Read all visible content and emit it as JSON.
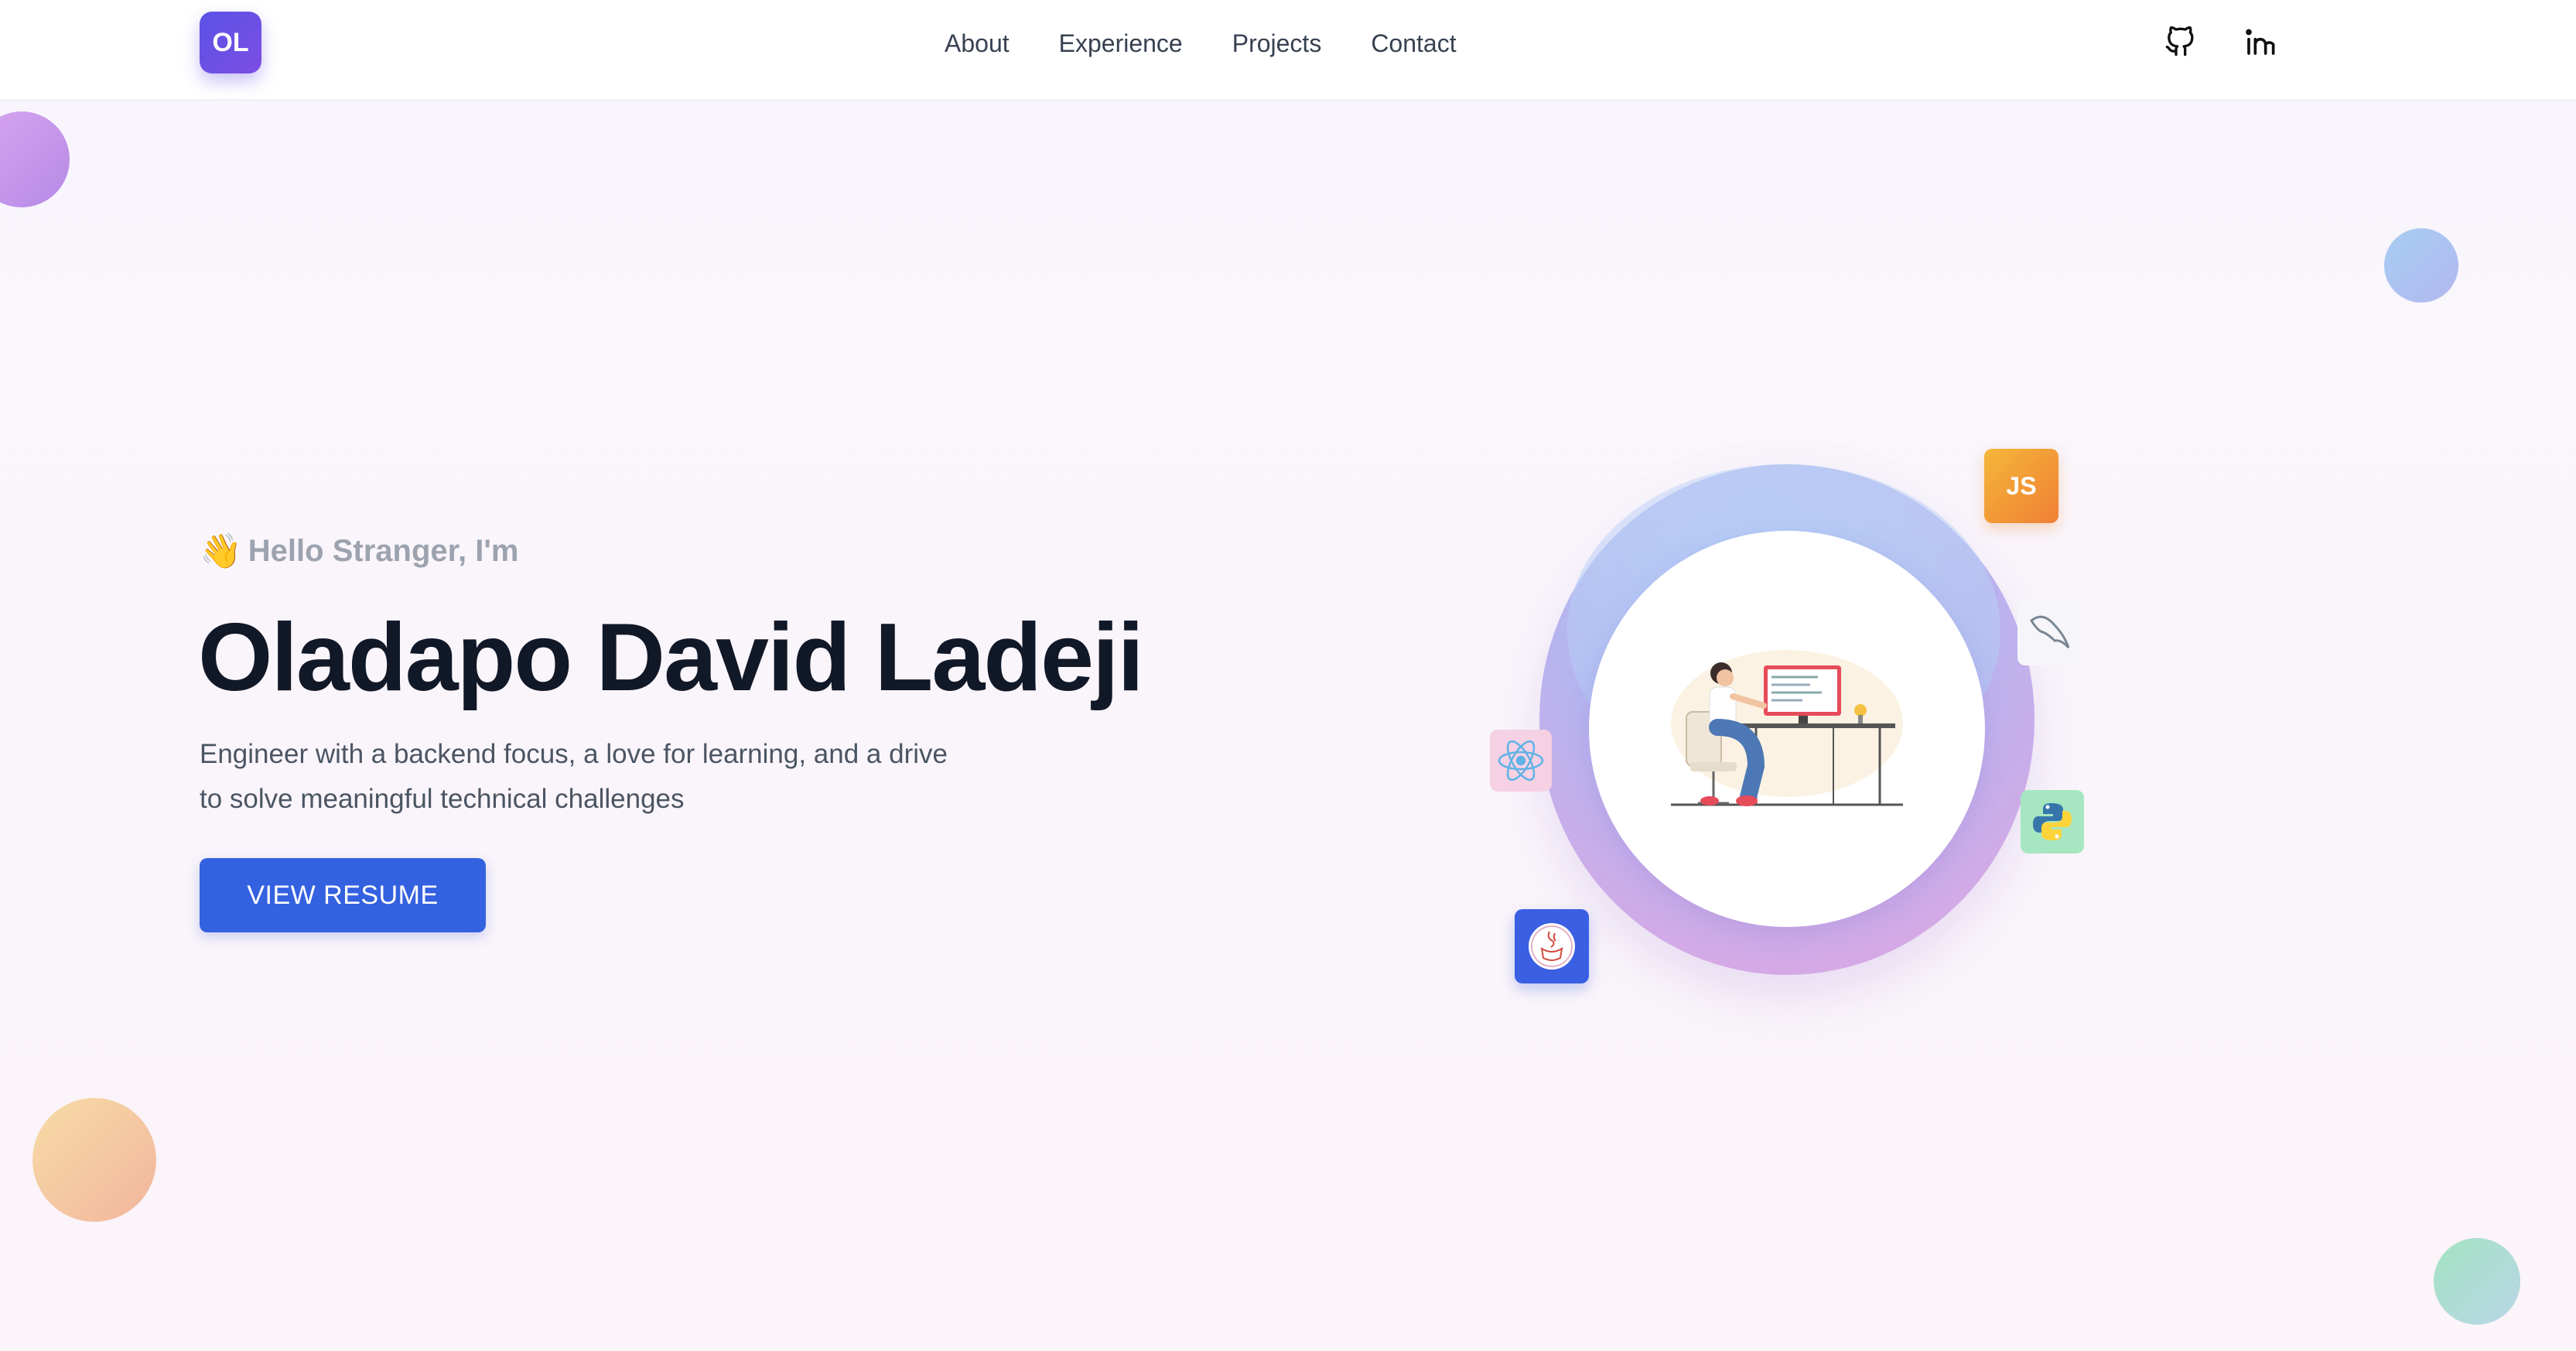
{
  "nav": {
    "logo": "OL",
    "links": [
      "About",
      "Experience",
      "Projects",
      "Contact"
    ],
    "social": [
      "github-icon",
      "linkedin-icon"
    ]
  },
  "hero": {
    "wave_emoji": "👋",
    "greeting": "Hello Stranger, I'm",
    "name": "Oladapo David Ladeji",
    "description": "Engineer with a backend focus, a love for learning, and a drive to solve meaningful technical challenges",
    "button": "VIEW RESUME"
  },
  "badges": {
    "js": "JS"
  },
  "colors": {
    "accent": "#3461e0",
    "logo": "#5b52e6",
    "heading": "#111827"
  }
}
